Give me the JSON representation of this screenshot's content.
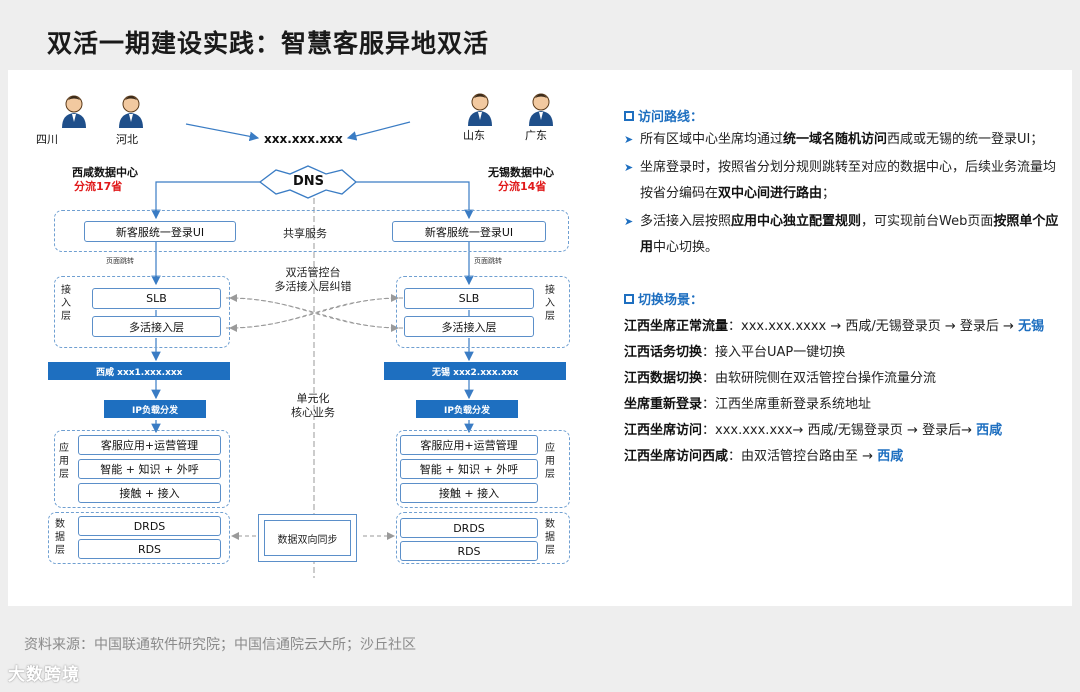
{
  "title": "双活一期建设实践：智慧客服异地双活",
  "diagram": {
    "persons_left": [
      "四川",
      "河北"
    ],
    "persons_right": [
      "山东",
      "广东"
    ],
    "domain": "xxx.xxx.xxx",
    "left_dc": {
      "name": "西咸数据中心",
      "split": "分流17省"
    },
    "right_dc": {
      "name": "无锡数据中心",
      "split": "分流14省"
    },
    "dns": "DNS",
    "login_ui": "新客服统一登录UI",
    "shared_service": "共享服务",
    "page_jump": "页面跳转",
    "console_note_line1": "双活管控台",
    "console_note_line2": "多活接入层纠错",
    "access_layer_label": "接入层",
    "slb": "SLB",
    "multi_access": "多活接入层",
    "left_bar": "西咸 xxx1.xxx.xxx",
    "right_bar": "无锡 xxx2.xxx.xxx",
    "ip_lb": "IP负载分发",
    "unit_note_line1": "单元化",
    "unit_note_line2": "核心业务",
    "app_layer_label": "应用层",
    "app_items": [
      "客服应用+运营管理",
      "智能 + 知识 + 外呼",
      "接触 + 接入"
    ],
    "data_layer_label": "数据层",
    "data_items": [
      "DRDS",
      "RDS"
    ],
    "sync": "数据双向同步"
  },
  "right": {
    "access_title": "访问路线：",
    "bullets": [
      [
        "所有区域中心坐席均通过",
        "统一域名随机访问",
        "西咸或无锡的统一登录UI；"
      ],
      [
        "坐席登录时，按照省分划分规则跳转至对应的数据中心，后续业务流量均按省分编码在",
        "双中心间进行路由",
        "；"
      ],
      [
        "多活接入层按照",
        "应用中心独立配置规则",
        "，可实现前台Web页面",
        "按照单个应用",
        "中心切换。"
      ]
    ],
    "switch_title": "切换场景：",
    "scenes": [
      {
        "bold": "江西坐席正常流量",
        "text": "：xxx.xxx.xxxx → 西咸/无锡登录页 → 登录后 →",
        "blue": "无锡"
      },
      {
        "bold": "江西话务切换",
        "text": "：接入平台UAP一键切换",
        "blue": ""
      },
      {
        "bold": "江西数据切换",
        "text": "：由软研院侧在双活管控台操作流量分流",
        "blue": ""
      },
      {
        "bold": "坐席重新登录",
        "text": "：江西坐席重新登录系统地址",
        "blue": ""
      },
      {
        "bold": "江西坐席访问",
        "text": "：xxx.xxx.xxx→ 西咸/无锡登录页 → 登录后→",
        "blue": "西咸"
      },
      {
        "bold": "江西坐席访问西咸",
        "text": "：由双活管控台路由至 →",
        "blue": "西咸"
      }
    ]
  },
  "source": "资料来源：中国联通软件研究院；中国信通院云大所；沙丘社区",
  "logo": "大数跨境"
}
